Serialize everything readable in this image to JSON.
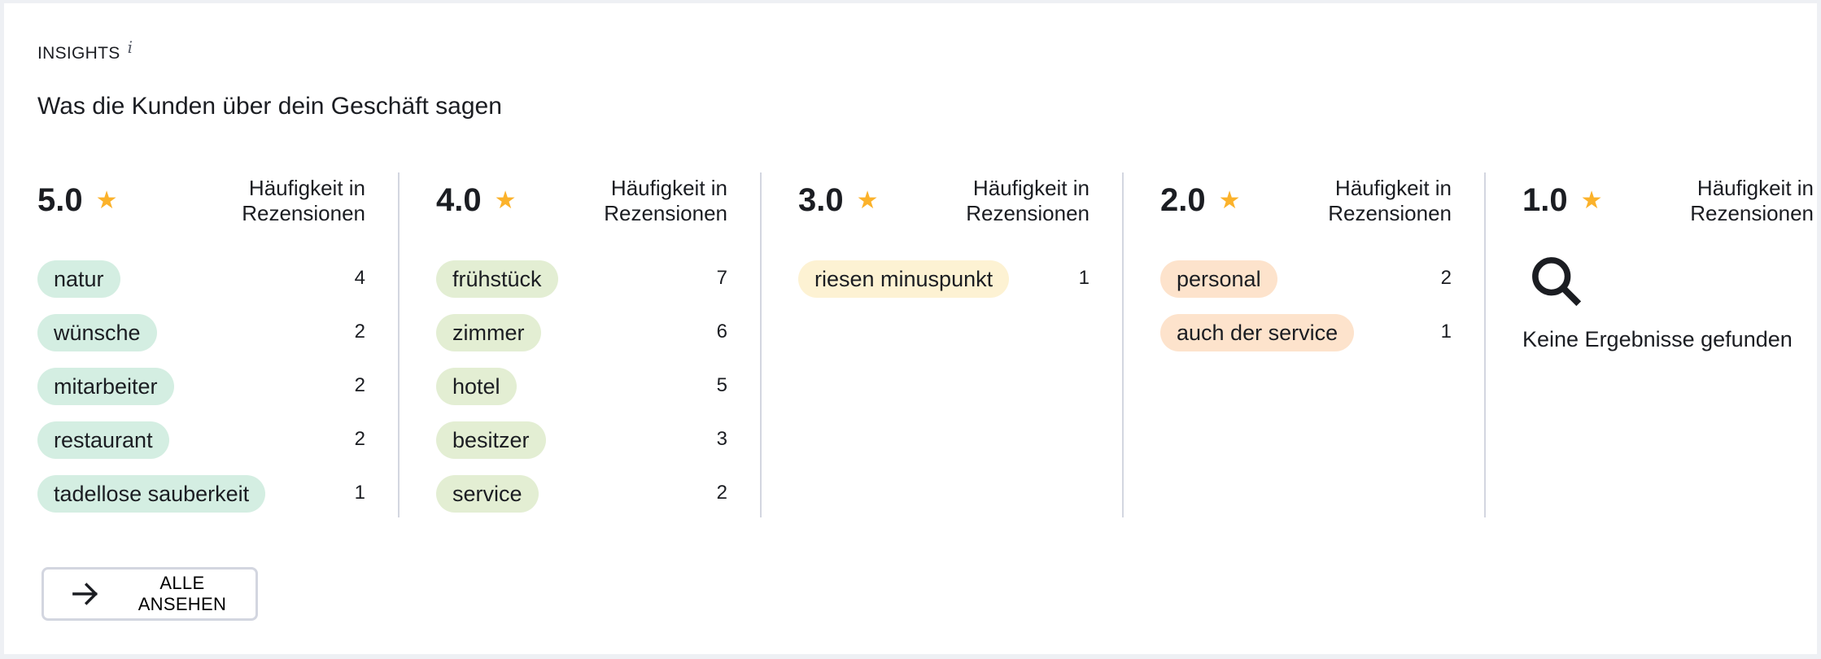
{
  "header": {
    "eyebrow": "INSIGHTS",
    "info_icon": "i",
    "subtitle": "Was die Kunden über dein Geschäft sagen"
  },
  "colors": {
    "star": "#fbb22b",
    "pill_5": "#d4eee2",
    "pill_4": "#e3eed3",
    "pill_3": "#fdf2d3",
    "pill_2": "#fde3cc",
    "divider": "#d3d6e0"
  },
  "columns": [
    {
      "rating": "5.0",
      "freq_label_1": "Häufigkeit in",
      "freq_label_2": "Rezensionen",
      "items": [
        {
          "label": "natur",
          "count": "4"
        },
        {
          "label": "wünsche",
          "count": "2"
        },
        {
          "label": "mitarbeiter",
          "count": "2"
        },
        {
          "label": "restaurant",
          "count": "2"
        },
        {
          "label": "tadellose sauberkeit",
          "count": "1"
        }
      ]
    },
    {
      "rating": "4.0",
      "freq_label_1": "Häufigkeit in",
      "freq_label_2": "Rezensionen",
      "items": [
        {
          "label": "frühstück",
          "count": "7"
        },
        {
          "label": "zimmer",
          "count": "6"
        },
        {
          "label": "hotel",
          "count": "5"
        },
        {
          "label": "besitzer",
          "count": "3"
        },
        {
          "label": "service",
          "count": "2"
        }
      ]
    },
    {
      "rating": "3.0",
      "freq_label_1": "Häufigkeit in",
      "freq_label_2": "Rezensionen",
      "items": [
        {
          "label": "riesen minuspunkt",
          "count": "1"
        }
      ]
    },
    {
      "rating": "2.0",
      "freq_label_1": "Häufigkeit in",
      "freq_label_2": "Rezensionen",
      "items": [
        {
          "label": "personal",
          "count": "2"
        },
        {
          "label": "auch der service",
          "count": "1"
        }
      ]
    },
    {
      "rating": "1.0",
      "freq_label_1": "Häufigkeit in",
      "freq_label_2": "Rezensionen",
      "items": [],
      "empty_icon": "search-icon",
      "empty_text": "Keine Ergebnisse gefunden"
    }
  ],
  "footer": {
    "button_label": "ALLE ANSEHEN",
    "button_icon": "arrow-right-icon"
  }
}
